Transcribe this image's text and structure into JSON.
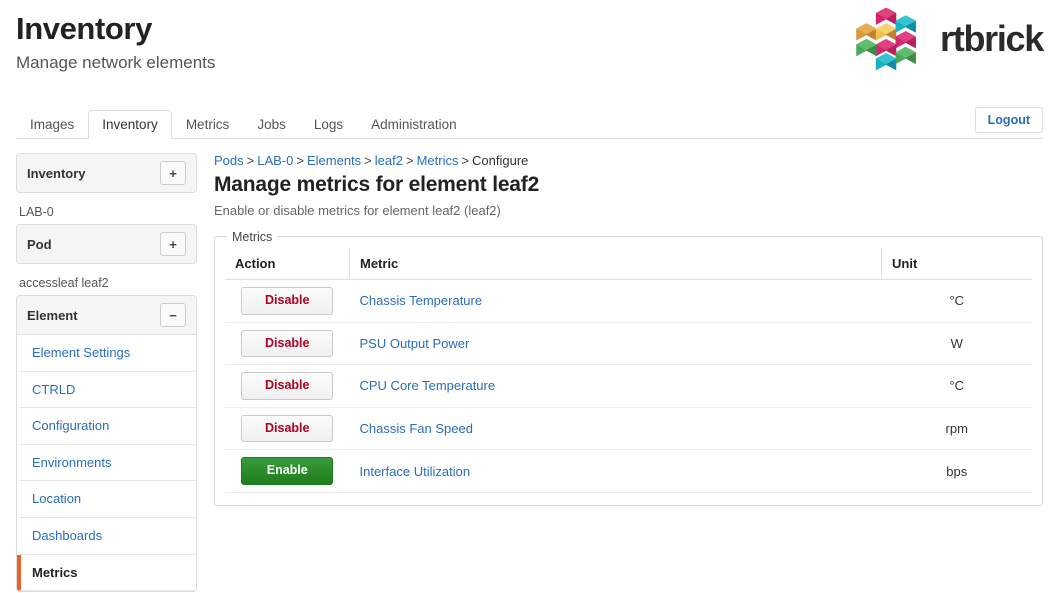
{
  "header": {
    "title": "Inventory",
    "subtitle": "Manage network elements",
    "brand_name": "rtbrick",
    "brand_colors": {
      "magenta": "#d6246e",
      "teal": "#16b0c4",
      "green": "#4aa85a",
      "orange": "#d99a3e",
      "yellow": "#f2c14a",
      "dark_pink": "#b81f5e"
    }
  },
  "tabs": [
    {
      "label": "Images",
      "active": false
    },
    {
      "label": "Inventory",
      "active": true
    },
    {
      "label": "Metrics",
      "active": false
    },
    {
      "label": "Jobs",
      "active": false
    },
    {
      "label": "Logs",
      "active": false
    },
    {
      "label": "Administration",
      "active": false
    }
  ],
  "logout": {
    "label": "Logout"
  },
  "sidebar": {
    "panels": [
      {
        "title": "Inventory",
        "toggle": "+",
        "toggle_state": "collapsed"
      },
      {
        "title": "Pod",
        "toggle": "+",
        "toggle_state": "collapsed",
        "group_label": "LAB-0"
      },
      {
        "title": "Element",
        "toggle": "−",
        "toggle_state": "expanded",
        "group_label": "accessleaf leaf2"
      }
    ],
    "element_links": [
      {
        "label": "Element Settings",
        "active": false
      },
      {
        "label": "CTRLD",
        "active": false
      },
      {
        "label": "Configuration",
        "active": false
      },
      {
        "label": "Environments",
        "active": false
      },
      {
        "label": "Location",
        "active": false
      },
      {
        "label": "Dashboards",
        "active": false
      },
      {
        "label": "Metrics",
        "active": true
      }
    ],
    "active_accent_color": "#e8622a"
  },
  "breadcrumb": {
    "items": [
      {
        "label": "Pods",
        "link": true
      },
      {
        "label": "LAB-0",
        "link": true
      },
      {
        "label": "Elements",
        "link": true
      },
      {
        "label": "leaf2",
        "link": true
      },
      {
        "label": "Metrics",
        "link": true
      },
      {
        "label": "Configure",
        "link": false
      }
    ],
    "separator": ">"
  },
  "page": {
    "title": "Manage metrics for element leaf2",
    "description": "Enable or disable metrics for element leaf2 (leaf2)"
  },
  "metrics_panel": {
    "legend": "Metrics",
    "columns": {
      "action": "Action",
      "metric": "Metric",
      "unit": "Unit"
    },
    "rows": [
      {
        "action": "Disable",
        "action_kind": "disable",
        "metric": "Chassis Temperature",
        "unit": "°C"
      },
      {
        "action": "Disable",
        "action_kind": "disable",
        "metric": "PSU Output Power",
        "unit": "W"
      },
      {
        "action": "Disable",
        "action_kind": "disable",
        "metric": "CPU Core Temperature",
        "unit": "°C"
      },
      {
        "action": "Disable",
        "action_kind": "disable",
        "metric": "Chassis Fan Speed",
        "unit": "rpm"
      },
      {
        "action": "Enable",
        "action_kind": "enable",
        "metric": "Interface Utilization",
        "unit": "bps"
      }
    ]
  }
}
